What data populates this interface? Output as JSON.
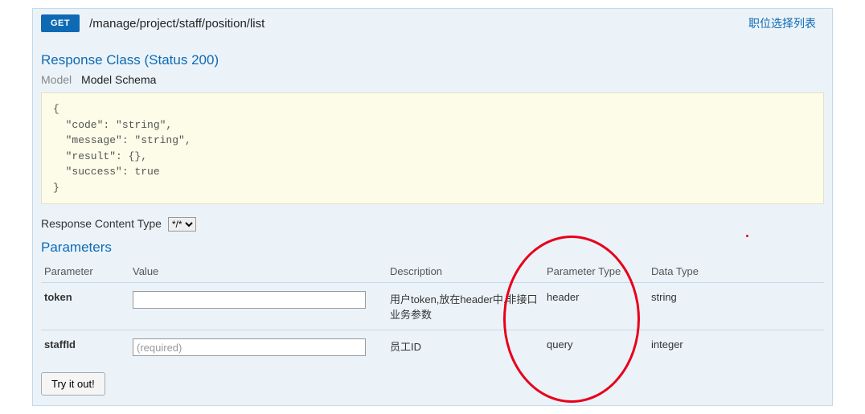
{
  "method": "GET",
  "path": "/manage/project/staff/position/list",
  "endpoint_name": "职位选择列表",
  "response_class_title": "Response Class (Status 200)",
  "tabs": {
    "model": "Model",
    "schema": "Model Schema"
  },
  "schema_json": "{\n  \"code\": \"string\",\n  \"message\": \"string\",\n  \"result\": {},\n  \"success\": true\n}",
  "content_type_label": "Response Content Type",
  "content_type_value": "*/*",
  "parameters_title": "Parameters",
  "columns": {
    "parameter": "Parameter",
    "value": "Value",
    "description": "Description",
    "parameter_type": "Parameter Type",
    "data_type": "Data Type"
  },
  "params": [
    {
      "name": "token",
      "value": "",
      "placeholder": "",
      "description": "用户token,放在header中,非接口业务参数",
      "parameter_type": "header",
      "data_type": "string"
    },
    {
      "name": "staffId",
      "value": "",
      "placeholder": "(required)",
      "description": "员工ID",
      "parameter_type": "query",
      "data_type": "integer"
    }
  ],
  "try_button": "Try it out!"
}
